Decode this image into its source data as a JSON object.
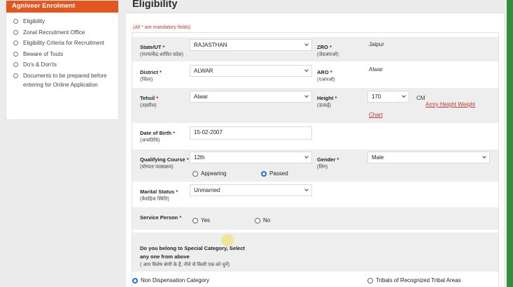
{
  "sidebar": {
    "title": "Agniveer Enrolment",
    "items": [
      {
        "label": "Eligibility"
      },
      {
        "label": "Zonal Recruitment Office"
      },
      {
        "label": "Eligibility Criteria for Recruitment"
      },
      {
        "label": "Beware of Touts"
      },
      {
        "label": "Do's & Don'ts"
      },
      {
        "label": "Documents to be prepared before entering for Online Application"
      }
    ]
  },
  "page": {
    "title": "Eligibility",
    "mandatory_note_prefix": "(All ",
    "mandatory_note_star": "*",
    "mandatory_note_suffix": " are mandatory fields)"
  },
  "form": {
    "state": {
      "label": "State/UT",
      "sub": "(राज्य/केंद्र शासित प्रदेश)",
      "value": "RAJASTHAN"
    },
    "zro": {
      "label": "ZRO",
      "sub": "(जेडआरओ)",
      "value": "Jaipur"
    },
    "district": {
      "label": "District",
      "sub": "(जिला)",
      "value": "ALWAR"
    },
    "aro": {
      "label": "ARO",
      "sub": "(एआरओ)",
      "value": "Alwar"
    },
    "tehsil": {
      "label": "Tehsil",
      "sub": "(तहसील)",
      "value": "Alwar"
    },
    "height": {
      "label": "Height",
      "sub": "(ऊंचाई)",
      "value": "170",
      "unit": "CM",
      "link1": "Army Height Weight",
      "link2": "Chart"
    },
    "dob": {
      "label": "Date of Birth",
      "sub": "(जन्मतिथि)",
      "value": "15-02-2007"
    },
    "course": {
      "label": "Qualifying Course",
      "sub": "(योग्यता पाठ्यक्रम)",
      "value": "12th",
      "opt1": "Appearing",
      "opt2": "Passed",
      "selected": "Passed"
    },
    "gender": {
      "label": "Gender",
      "sub": "(लिंग)",
      "value": "Male"
    },
    "marital": {
      "label": "Marital Status",
      "sub": "(वैवाहिक स्थिति)",
      "value": "Unmarried"
    },
    "service": {
      "label": "Service Person",
      "opt1": "Yes",
      "opt2": "No"
    },
    "special": {
      "line1": "Do you belong to Special Category, Select",
      "line2": "any one from above",
      "line3": "( आप विशेष श्रेणी के हैं, नीचे से किसी एक को चुनें)",
      "opt1": "Non Dispensation Category",
      "opt2": "Tribals of Recognized Tribal Areas",
      "selected": "Non Dispensation Category"
    }
  },
  "colors": {
    "accent": "#e4561f",
    "required": "#d0021b",
    "radio": "#1a6fe0",
    "side_strip": "#2f8f3a"
  }
}
